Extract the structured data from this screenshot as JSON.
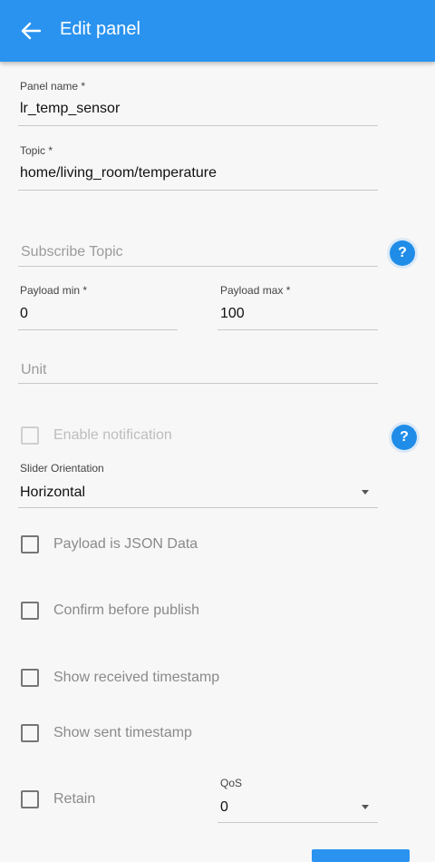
{
  "appbar": {
    "title": "Edit panel",
    "back_icon": "arrow-left-icon"
  },
  "form": {
    "panel_name": {
      "label": "Panel name *",
      "value": "lr_temp_sensor"
    },
    "topic": {
      "label": "Topic *",
      "value": "home/living_room/temperature"
    },
    "subscribe_topic": {
      "placeholder": "Subscribe Topic"
    },
    "payload_min": {
      "label": "Payload min *",
      "value": "0"
    },
    "payload_max": {
      "label": "Payload max *",
      "value": "100"
    },
    "unit": {
      "placeholder": "Unit"
    },
    "enable_notification": {
      "label": "Enable notification",
      "checked": false,
      "disabled": true
    },
    "slider_orientation": {
      "label": "Slider Orientation",
      "value": "Horizontal"
    },
    "payload_json": {
      "label": "Payload is JSON Data",
      "checked": false
    },
    "confirm_publish": {
      "label": "Confirm before publish",
      "checked": false
    },
    "show_received_ts": {
      "label": "Show received timestamp",
      "checked": false
    },
    "show_sent_ts": {
      "label": "Show sent timestamp",
      "checked": false
    },
    "retain": {
      "label": "Retain",
      "checked": false
    },
    "qos": {
      "label": "QoS",
      "value": "0"
    }
  },
  "help_icon": {
    "symbol": "?",
    "icon": "help-circle-icon"
  },
  "colors": {
    "primary": "#2a93ef",
    "background": "#f7f7f7"
  }
}
